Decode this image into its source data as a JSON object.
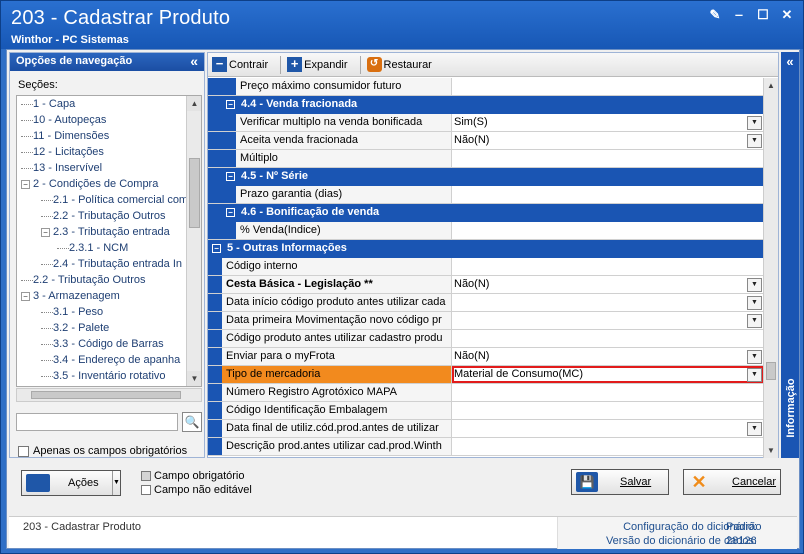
{
  "window": {
    "title": "203 - Cadastrar  Produto",
    "subtitle": "Winthor - PC Sistemas",
    "controls": [
      "edit-icon",
      "minimize-icon",
      "maximize-icon",
      "close-icon"
    ]
  },
  "nav": {
    "header": "Opções de navegação",
    "collapse_glyph": "«",
    "sections_label": "Seções:",
    "items": [
      {
        "label": "1 - Capa",
        "level": 1,
        "expander": ""
      },
      {
        "label": "10 - Autopeças",
        "level": 1,
        "expander": ""
      },
      {
        "label": "11 - Dimensões",
        "level": 1,
        "expander": ""
      },
      {
        "label": "12 - Licitações",
        "level": 1,
        "expander": ""
      },
      {
        "label": "13 - Inservível",
        "level": 1,
        "expander": ""
      },
      {
        "label": "2 - Condições de Compra",
        "level": 1,
        "expander": "−"
      },
      {
        "label": "2.1 - Política comercial comp",
        "level": 2,
        "expander": ""
      },
      {
        "label": "2.2 - Tributação Outros",
        "level": 2,
        "expander": ""
      },
      {
        "label": "2.3 - Tributação entrada",
        "level": 2,
        "expander": "−"
      },
      {
        "label": "2.3.1 - NCM",
        "level": 3,
        "expander": ""
      },
      {
        "label": "2.4 - Tributação entrada In",
        "level": 2,
        "expander": ""
      },
      {
        "label": "2.2 - Tributação Outros",
        "level": 1,
        "expander": ""
      },
      {
        "label": "3 - Armazenagem",
        "level": 1,
        "expander": "−"
      },
      {
        "label": "3.1 - Peso",
        "level": 2,
        "expander": ""
      },
      {
        "label": "3.2 - Palete",
        "level": 2,
        "expander": ""
      },
      {
        "label": "3.3 - Código de Barras",
        "level": 2,
        "expander": ""
      },
      {
        "label": "3.4 - Endereço de apanha",
        "level": 2,
        "expander": ""
      },
      {
        "label": "3.5 - Inventário rotativo",
        "level": 2,
        "expander": ""
      }
    ],
    "search_placeholder": "",
    "search_icon": "magnifier-icon",
    "required_only_label": "Apenas os campos obrigatórios"
  },
  "toolbar": {
    "contract_label": "Contrair",
    "expand_label": "Expandir",
    "restore_label": "Restaurar"
  },
  "grid": {
    "rows": [
      {
        "type": "field",
        "indent": 2,
        "label": "Preço máximo consumidor futuro",
        "value": "",
        "dropdown": false,
        "bold": false
      },
      {
        "type": "section",
        "indent": 1,
        "label": "4.4 - Venda fracionada"
      },
      {
        "type": "field",
        "indent": 2,
        "label": "Verificar multiplo na venda bonificada",
        "value": "Sim(S)",
        "dropdown": true,
        "bold": false
      },
      {
        "type": "field",
        "indent": 2,
        "label": "Aceita venda fracionada",
        "value": "Não(N)",
        "dropdown": true,
        "bold": false
      },
      {
        "type": "field",
        "indent": 2,
        "label": "Múltiplo",
        "value": "",
        "dropdown": false,
        "bold": false
      },
      {
        "type": "section",
        "indent": 1,
        "label": "4.5 - Nº Série"
      },
      {
        "type": "field",
        "indent": 2,
        "label": "Prazo garantia (dias)",
        "value": "",
        "dropdown": false,
        "bold": false
      },
      {
        "type": "section",
        "indent": 1,
        "label": "4.6 - Bonificação de venda"
      },
      {
        "type": "field",
        "indent": 2,
        "label": "% Venda(Indice)",
        "value": "",
        "dropdown": false,
        "bold": false
      },
      {
        "type": "section",
        "indent": 0,
        "label": "5 - Outras Informações"
      },
      {
        "type": "field",
        "indent": 1,
        "label": "Código interno",
        "value": "",
        "dropdown": false,
        "bold": false
      },
      {
        "type": "field",
        "indent": 1,
        "label": "Cesta Básica - Legislação **",
        "value": "Não(N)",
        "dropdown": true,
        "bold": true
      },
      {
        "type": "field",
        "indent": 1,
        "label": "Data início código produto antes utilizar cada",
        "value": "",
        "dropdown": true,
        "bold": false
      },
      {
        "type": "field",
        "indent": 1,
        "label": "Data primeira Movimentação novo código pr",
        "value": "",
        "dropdown": true,
        "bold": false
      },
      {
        "type": "field",
        "indent": 1,
        "label": "Código produto antes utilizar cadastro produ",
        "value": "",
        "dropdown": false,
        "bold": false
      },
      {
        "type": "field",
        "indent": 1,
        "label": "Enviar para o myFrota",
        "value": "Não(N)",
        "dropdown": true,
        "bold": false
      },
      {
        "type": "field",
        "indent": 1,
        "label": "Tipo de mercadoria",
        "value": "Material de Consumo(MC)",
        "dropdown": true,
        "bold": false,
        "highlight": true
      },
      {
        "type": "field",
        "indent": 1,
        "label": "Número Registro Agrotóxico MAPA",
        "value": "",
        "dropdown": false,
        "bold": false
      },
      {
        "type": "field",
        "indent": 1,
        "label": "Código Identificação Embalagem",
        "value": "",
        "dropdown": false,
        "bold": false
      },
      {
        "type": "field",
        "indent": 1,
        "label": "Data final de utiliz.cód.prod.antes de utilizar",
        "value": "",
        "dropdown": true,
        "bold": false
      },
      {
        "type": "field",
        "indent": 1,
        "label": "Descrição prod.antes utilizar cad.prod.Winth",
        "value": "",
        "dropdown": false,
        "bold": false
      }
    ]
  },
  "info_tab": {
    "label": "Informação",
    "collapse_glyph": "«"
  },
  "footer": {
    "actions_label": "Ações",
    "legend_required": "Campo obrigatório",
    "legend_readonly": "Campo não editável",
    "save_label": "Salvar",
    "cancel_label": "Cancelar"
  },
  "status": {
    "left": "203 - Cadastrar  Produto",
    "config_label": "Configuração do dicionário:",
    "config_value": "Padrão",
    "version_label": "Versão do dicionário de dados:",
    "version_value": "28126"
  },
  "colors": {
    "title_blue": "#1757b5",
    "section_blue": "#1a55b3",
    "highlight_orange": "#f28a1e",
    "highlight_border": "#e21b1b"
  }
}
